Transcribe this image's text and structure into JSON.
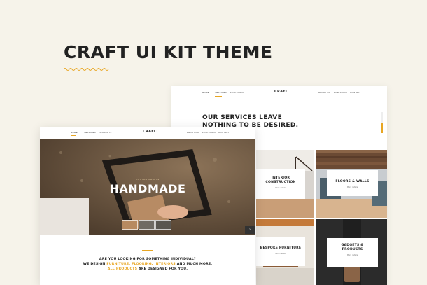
{
  "headline": "CRAFT UI KIT THEME",
  "colors": {
    "accent": "#e8a623",
    "background": "#f6f3ea"
  },
  "back_page": {
    "nav_left": [
      "HOME",
      "SERVICES",
      "PORTFOLIO"
    ],
    "logo": "CRAFC",
    "nav_right": [
      "ABOUT US",
      "PORTFOLIO",
      "CONTACT"
    ],
    "heading_line1": "OUR SERVICES LEAVE",
    "heading_line2": "NOTHING TO BE DESIRED.",
    "tiles": [
      {
        "title_1": "INTERIOR",
        "title_2": "CONSTRUCTION",
        "sub": "More details"
      },
      {
        "title_1": "FLOORS & WALLS",
        "title_2": "",
        "sub": "More details"
      },
      {
        "title_1": "BESPOKE FURNITURE",
        "title_2": "",
        "sub": "More details"
      },
      {
        "title_1": "GADGETS &",
        "title_2": "PRODUCTS",
        "sub": "More details"
      }
    ]
  },
  "front_page": {
    "nav_left": [
      "HOME",
      "SERVICES",
      "PRODUCTS"
    ],
    "logo": "CRAFC",
    "nav_right": [
      "ABOUT US",
      "PORTFOLIO",
      "CONTACT"
    ],
    "hero_subtitle": "CUSTOM CRAFTS",
    "hero_title": "HANDMADE",
    "slider_arrow": "›",
    "intro_line1": "ARE YOU LOOKING FOR SOMETHING INDIVIDUAL?",
    "intro_line2_a": "WE DESIGN",
    "intro_line2_hl1": "FURNITURE,",
    "intro_line2_hl2": "FLOORING,",
    "intro_line2_hl3": "INTERIORS",
    "intro_line2_b": "AND MUCH MORE.",
    "intro_line3_hl": "ALL PRODUCTS",
    "intro_line3_b": "ARE DESIGNED FOR YOU."
  }
}
